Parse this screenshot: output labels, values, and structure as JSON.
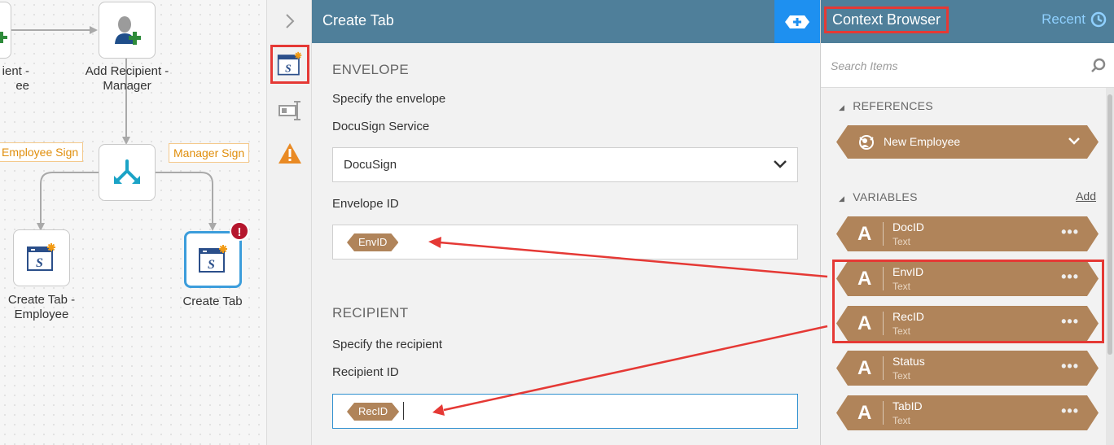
{
  "canvas": {
    "nodes": [
      {
        "id": "add_recipient_employee",
        "label_lines": [
          "ient -",
          "ee"
        ],
        "icon": "user-add-icon"
      },
      {
        "id": "add_recipient_manager",
        "label_lines": [
          "Add Recipient -",
          "Manager"
        ],
        "icon": "user-add-icon"
      },
      {
        "id": "decision",
        "label_lines": [],
        "icon": "branch-split-icon"
      },
      {
        "id": "create_tab_employee",
        "label_lines": [
          "Create Tab -",
          "Employee"
        ],
        "icon": "docusign-tab-icon"
      },
      {
        "id": "create_tab",
        "label_lines": [
          "Create Tab"
        ],
        "icon": "docusign-tab-icon",
        "selected": true,
        "error_badge": "!"
      }
    ],
    "branch_labels": [
      "Employee Sign",
      "Manager Sign"
    ]
  },
  "toolbar": {
    "collapse_icon": "chevron-right-icon",
    "tools": [
      {
        "icon": "docusign-tab-icon",
        "active": true
      },
      {
        "icon": "form-field-icon",
        "active": false
      },
      {
        "icon": "warning-icon",
        "active": false
      }
    ]
  },
  "props": {
    "title": "Create Tab",
    "add_icon": "add-token-icon",
    "envelope": {
      "section_title": "ENVELOPE",
      "description": "Specify the envelope",
      "service_label": "DocuSign Service",
      "service_value": "DocuSign",
      "envelope_id_label": "Envelope ID",
      "envelope_id_token": "EnvID"
    },
    "recipient": {
      "section_title": "RECIPIENT",
      "description": "Specify the recipient",
      "recipient_id_label": "Recipient ID",
      "recipient_id_token": "RecID"
    }
  },
  "context": {
    "title": "Context Browser",
    "recent_label": "Recent",
    "search_placeholder": "Search Items",
    "references": {
      "section_title": "REFERENCES",
      "items": [
        {
          "label": "New Employee"
        }
      ]
    },
    "variables": {
      "section_title": "VARIABLES",
      "add_label": "Add",
      "items": [
        {
          "name": "DocID",
          "type": "Text"
        },
        {
          "name": "EnvID",
          "type": "Text"
        },
        {
          "name": "RecID",
          "type": "Text"
        },
        {
          "name": "Status",
          "type": "Text"
        },
        {
          "name": "TabID",
          "type": "Text"
        }
      ],
      "more_label": "•••"
    }
  },
  "colors": {
    "header": "#4f7f9a",
    "token": "#b0845a",
    "highlight": "#e53935",
    "accent_blue": "#1e90f0",
    "warning": "#e98a24",
    "error": "#b5162d"
  }
}
